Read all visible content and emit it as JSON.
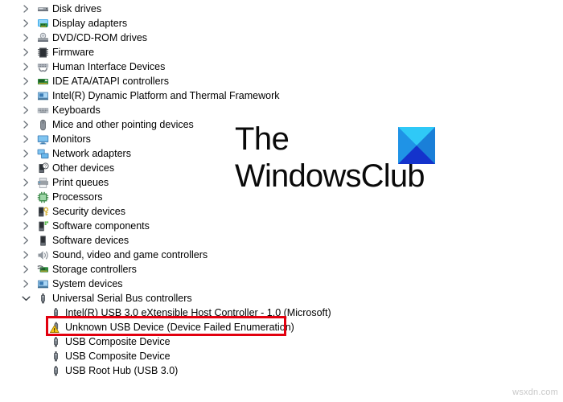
{
  "window": {
    "app": "Device Manager",
    "background_color": "#ffffff"
  },
  "tree": {
    "rows": [
      {
        "label": "Disk drives",
        "icon": "disk-drive-icon",
        "chevron": "collapsed",
        "level": 1
      },
      {
        "label": "Display adapters",
        "icon": "display-adapter-icon",
        "chevron": "collapsed",
        "level": 1
      },
      {
        "label": "DVD/CD-ROM drives",
        "icon": "dvd-drive-icon",
        "chevron": "collapsed",
        "level": 1
      },
      {
        "label": "Firmware",
        "icon": "firmware-icon",
        "chevron": "collapsed",
        "level": 1
      },
      {
        "label": "Human Interface Devices",
        "icon": "hid-icon",
        "chevron": "collapsed",
        "level": 1
      },
      {
        "label": "IDE ATA/ATAPI controllers",
        "icon": "ide-controller-icon",
        "chevron": "collapsed",
        "level": 1
      },
      {
        "label": "Intel(R) Dynamic Platform and Thermal Framework",
        "icon": "system-device-icon",
        "chevron": "collapsed",
        "level": 1
      },
      {
        "label": "Keyboards",
        "icon": "keyboard-icon",
        "chevron": "collapsed",
        "level": 1
      },
      {
        "label": "Mice and other pointing devices",
        "icon": "mouse-icon",
        "chevron": "collapsed",
        "level": 1
      },
      {
        "label": "Monitors",
        "icon": "monitor-icon",
        "chevron": "collapsed",
        "level": 1
      },
      {
        "label": "Network adapters",
        "icon": "network-adapter-icon",
        "chevron": "collapsed",
        "level": 1
      },
      {
        "label": "Other devices",
        "icon": "other-device-icon",
        "chevron": "collapsed",
        "level": 1
      },
      {
        "label": "Print queues",
        "icon": "printer-icon",
        "chevron": "collapsed",
        "level": 1
      },
      {
        "label": "Processors",
        "icon": "processor-icon",
        "chevron": "collapsed",
        "level": 1
      },
      {
        "label": "Security devices",
        "icon": "security-device-icon",
        "chevron": "collapsed",
        "level": 1
      },
      {
        "label": "Software components",
        "icon": "software-component-icon",
        "chevron": "collapsed",
        "level": 1
      },
      {
        "label": "Software devices",
        "icon": "software-device-icon",
        "chevron": "collapsed",
        "level": 1
      },
      {
        "label": "Sound, video and game controllers",
        "icon": "sound-controller-icon",
        "chevron": "collapsed",
        "level": 1
      },
      {
        "label": "Storage controllers",
        "icon": "storage-controller-icon",
        "chevron": "collapsed",
        "level": 1
      },
      {
        "label": "System devices",
        "icon": "system-device-icon",
        "chevron": "collapsed",
        "level": 1
      },
      {
        "label": "Universal Serial Bus controllers",
        "icon": "usb-icon",
        "chevron": "expanded",
        "level": 1
      },
      {
        "label": "Intel(R) USB 3.0 eXtensible Host Controller - 1.0 (Microsoft)",
        "icon": "usb-icon",
        "chevron": "none",
        "level": 2
      },
      {
        "label": "Unknown USB Device (Device Failed Enumeration)",
        "icon": "usb-warning-icon",
        "chevron": "none",
        "level": 2,
        "error": true
      },
      {
        "label": "USB Composite Device",
        "icon": "usb-icon",
        "chevron": "none",
        "level": 2
      },
      {
        "label": "USB Composite Device",
        "icon": "usb-icon",
        "chevron": "none",
        "level": 2
      },
      {
        "label": "USB Root Hub (USB 3.0)",
        "icon": "usb-icon",
        "chevron": "none",
        "level": 2
      }
    ]
  },
  "highlight": {
    "target_label": "Unknown USB Device (Device Failed Enumeration)",
    "border_color": "#e2000f"
  },
  "brand": {
    "line1": "The",
    "line2": "WindowsClub",
    "mark_colors": {
      "top": "#29c5f6",
      "left": "#1f8fe0",
      "right": "#1f8fe0",
      "bottom": "#1433cc"
    }
  },
  "watermark": {
    "text": "wsxdn.com",
    "color": "#c9c9c9"
  }
}
